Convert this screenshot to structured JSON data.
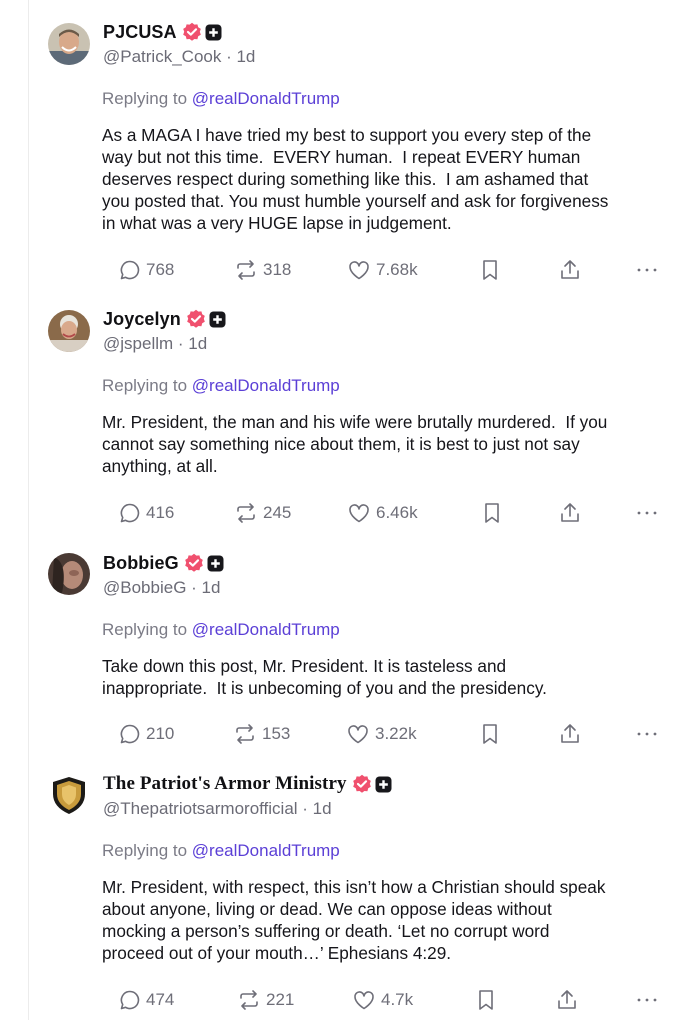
{
  "colors": {
    "verified": "#f0506e",
    "mention": "#5b3fd6",
    "muted": "#6b6b76"
  },
  "replying_label": "Replying to",
  "posts": [
    {
      "display_name": "PJCUSA",
      "handle_line": "@Patrick_Cook · 1d",
      "mention": "@realDonaldTrump",
      "body": "As a MAGA I have tried my best to support you every step of the\nway but not this time.  EVERY human.  I repeat EVERY human\ndeserves respect during something like this.  I am ashamed that\nyou posted that. You must humble yourself and ask for forgiveness\nin what was a very HUGE lapse in judgement.",
      "replies": "768",
      "reposts": "318",
      "likes": "7.68k",
      "avatar": "avatar-photo"
    },
    {
      "display_name": "Joycelyn",
      "handle_line": "@jspellm · 1d",
      "mention": "@realDonaldTrump",
      "body": "Mr. President, the man and his wife were brutally murdered.  If you\ncannot say something nice about them, it is best to just not say\nanything, at all.",
      "replies": "416",
      "reposts": "245",
      "likes": "6.46k",
      "avatar": "avatar-photo"
    },
    {
      "display_name": "BobbieG",
      "handle_line": "@BobbieG · 1d",
      "mention": "@realDonaldTrump",
      "body": "Take down this post, Mr. President. It is tasteless and\ninappropriate.  It is unbecoming of you and the presidency.",
      "replies": "210",
      "reposts": "153",
      "likes": "3.22k",
      "avatar": "avatar-photo"
    },
    {
      "display_name": "The Patriot's Armor Ministry",
      "handle_line": "@Thepatriotsarmorofficial · 1d",
      "mention": "@realDonaldTrump",
      "body": "Mr. President, with respect, this isn’t how a Christian should speak\nabout anyone, living or dead. We can oppose ideas without\nmocking a person’s suffering or death. ‘Let no corrupt word\nproceed out of your mouth…’ Ephesians 4:29.",
      "replies": "474",
      "reposts": "221",
      "likes": "4.7k",
      "avatar": "shield-logo"
    }
  ]
}
